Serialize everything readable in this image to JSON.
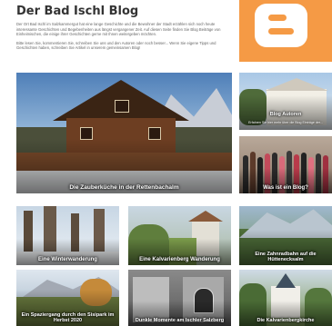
{
  "header": {
    "title": "Der Bad Ischl Blog",
    "intro_1": "Der Ort Bad Ischl im Salzkammergut hat eine lange Geschichte und die Bewohner der Stadt erzählen sich noch heute interessante Geschichten und Begebenheiten aus längst vergangener Zeit. Auf diesen Seite finden Sie Blog Beiträge von Einheimischen, die einige ihrer Geschichten gerne mit Ihnen weitergeben möchten.",
    "intro_2": "Bitte lesen Sie, kommentieren Sie, schreiben Sie uns und den Autoren oder noch besser... Wenn Sie eigene Tipps und Geschichten haben, schreiben Sie Artikel in unserem gemeinsamen Blog!"
  },
  "logo": {
    "icon": "blogger-logo-icon",
    "color": "#f59a45"
  },
  "tiles": {
    "featured": {
      "label": "Die Zauberküche in der Rettenbachalm"
    },
    "autoren": {
      "label": "Blog Autoren",
      "sub": "Erfahren Sie hier mehr über die Blog Einträge der..."
    },
    "was_ist": {
      "label": "Was ist ein Blog?"
    },
    "winter": {
      "label": "Eine Winterwanderung"
    },
    "kalvarienberg": {
      "label": "Eine Kalvarienberg Wanderung"
    },
    "zahnradbahn": {
      "label": "Eine Zahnradbahn auf die Hüttenecksalm"
    },
    "spaziergang": {
      "label": "Ein Spaziergang durch den Sisipark im Herbst 2020"
    },
    "dunkle": {
      "label": "Dunkle Momente am Ischler Salzberg"
    },
    "kirche": {
      "label": "Die Kalvarienbergkirche"
    }
  }
}
